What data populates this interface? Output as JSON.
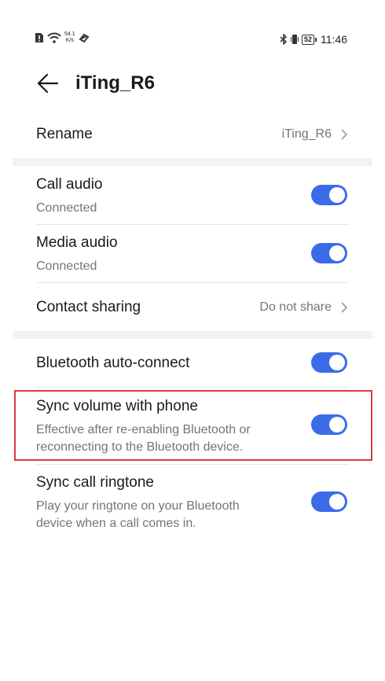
{
  "status_bar": {
    "net_speed_value": "54.1",
    "net_speed_unit": "K/s",
    "battery": "52",
    "time": "11:46"
  },
  "header": {
    "title": "iTing_R6"
  },
  "rename": {
    "label": "Rename",
    "value": "iTing_R6"
  },
  "call_audio": {
    "label": "Call audio",
    "status": "Connected",
    "enabled": true
  },
  "media_audio": {
    "label": "Media audio",
    "status": "Connected",
    "enabled": true
  },
  "contact_sharing": {
    "label": "Contact sharing",
    "value": "Do not share"
  },
  "auto_connect": {
    "label": "Bluetooth auto-connect",
    "enabled": true
  },
  "sync_volume": {
    "label": "Sync volume with phone",
    "description_line1": "Effective after re-enabling Bluetooth or",
    "description_line2": "reconnecting to the Bluetooth device.",
    "enabled": true
  },
  "sync_ringtone": {
    "label": "Sync call ringtone",
    "description_line1": "Play your ringtone on your Bluetooth",
    "description_line2": "device when a call comes in.",
    "enabled": true
  },
  "colors": {
    "toggle_on": "#3b6ce8",
    "highlight": "#e0393e"
  }
}
